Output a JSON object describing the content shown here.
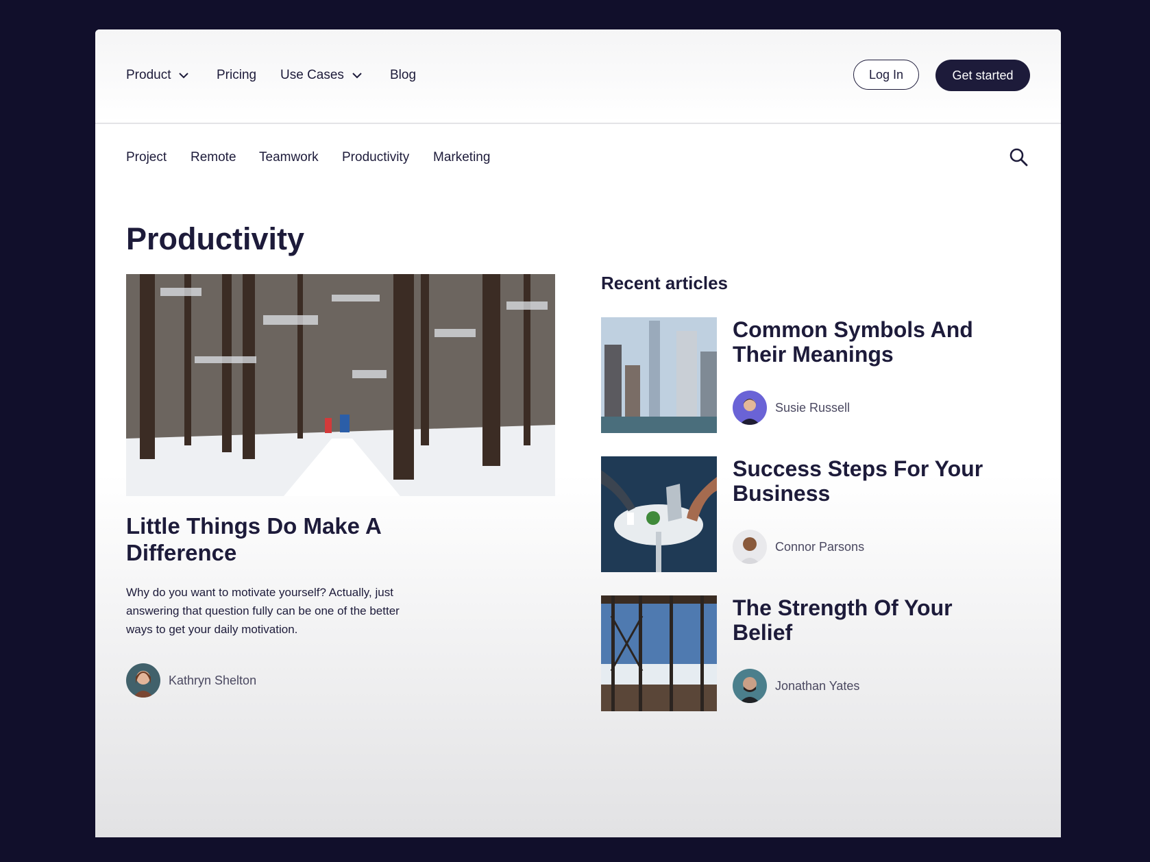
{
  "nav": {
    "items": [
      {
        "label": "Product",
        "has_dropdown": true
      },
      {
        "label": "Pricing",
        "has_dropdown": false
      },
      {
        "label": "Use Cases",
        "has_dropdown": true
      },
      {
        "label": "Blog",
        "has_dropdown": false
      }
    ],
    "login_label": "Log In",
    "cta_label": "Get started"
  },
  "categories": [
    "Project",
    "Remote",
    "Teamwork",
    "Productivity",
    "Marketing"
  ],
  "page_title": "Productivity",
  "featured": {
    "title": "Little Things Do Make A Difference",
    "description": "Why do you want to motivate yourself? Actually, just answering that question fully can be one of the better ways to get your daily motivation.",
    "author": "Kathryn Shelton"
  },
  "recent": {
    "heading": "Recent articles",
    "articles": [
      {
        "title": "Common Symbols And Their Meanings",
        "author": "Susie Russell"
      },
      {
        "title": "Success Steps For Your Business",
        "author": "Connor Parsons"
      },
      {
        "title": "The Strength Of Your Belief",
        "author": "Jonathan Yates"
      }
    ]
  },
  "colors": {
    "background": "#110f2b",
    "text": "#1d1b3a",
    "button": "#1d1b3a"
  },
  "icons": [
    "chevron-down-icon",
    "search-icon"
  ]
}
